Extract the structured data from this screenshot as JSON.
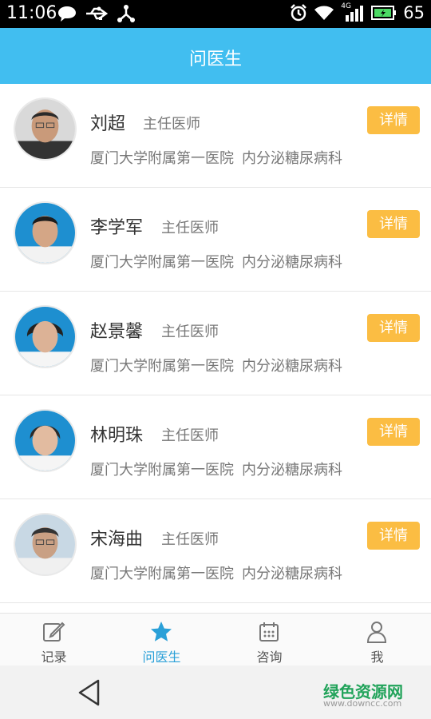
{
  "status_bar": {
    "time": "11:06",
    "network": "4G",
    "battery": "65",
    "icons": [
      "message-icon",
      "usb-icon",
      "share-icon",
      "alarm-icon",
      "wifi-icon",
      "signal-icon",
      "battery-icon"
    ]
  },
  "header": {
    "title": "问医生"
  },
  "doctors": [
    {
      "name": "刘超",
      "title": "主任医师",
      "hospital": "厦门大学附属第一医院",
      "department": "内分泌糖尿病科",
      "detail_label": "详情"
    },
    {
      "name": "李学军",
      "title": "主任医师",
      "hospital": "厦门大学附属第一医院",
      "department": "内分泌糖尿病科",
      "detail_label": "详情"
    },
    {
      "name": "赵景馨",
      "title": "主任医师",
      "hospital": "厦门大学附属第一医院",
      "department": "内分泌糖尿病科",
      "detail_label": "详情"
    },
    {
      "name": "林明珠",
      "title": "主任医师",
      "hospital": "厦门大学附属第一医院",
      "department": "内分泌糖尿病科",
      "detail_label": "详情"
    },
    {
      "name": "宋海曲",
      "title": "主任医师",
      "hospital": "厦门大学附属第一医院",
      "department": "内分泌糖尿病科",
      "detail_label": "详情"
    }
  ],
  "bottom_nav": [
    {
      "label": "记录",
      "icon": "edit-icon",
      "active": false
    },
    {
      "label": "问医生",
      "icon": "star-icon",
      "active": true
    },
    {
      "label": "咨询",
      "icon": "calendar-icon",
      "active": false
    },
    {
      "label": "我",
      "icon": "person-icon",
      "active": false
    }
  ],
  "watermark": {
    "title": "绿色资源网",
    "url": "www.downcc.com"
  },
  "colors": {
    "header": "#41bef0",
    "detail_button": "#fbbd43",
    "active_tab": "#2aa0d8"
  }
}
